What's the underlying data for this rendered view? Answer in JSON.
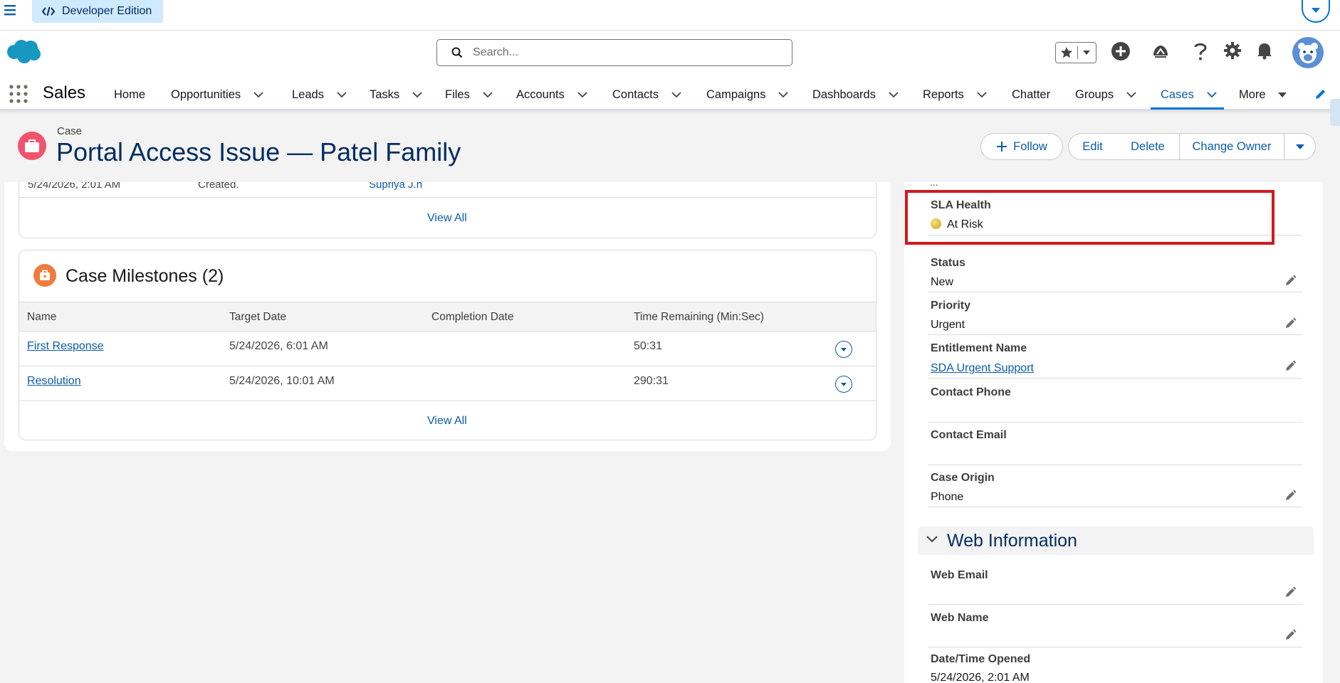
{
  "top": {
    "edition": "Developer Edition"
  },
  "header": {
    "search_placeholder": "Search..."
  },
  "nav": {
    "app_name": "Sales",
    "items": [
      {
        "label": "Home"
      },
      {
        "label": "Opportunities"
      },
      {
        "label": "Leads"
      },
      {
        "label": "Tasks"
      },
      {
        "label": "Files"
      },
      {
        "label": "Accounts"
      },
      {
        "label": "Contacts"
      },
      {
        "label": "Campaigns"
      },
      {
        "label": "Dashboards"
      },
      {
        "label": "Reports"
      },
      {
        "label": "Chatter"
      },
      {
        "label": "Groups"
      },
      {
        "label": "Cases"
      },
      {
        "label": "More"
      }
    ]
  },
  "record": {
    "type": "Case",
    "title": "Portal Access Issue — Patel Family",
    "actions": {
      "follow": "Follow",
      "edit": "Edit",
      "delete": "Delete",
      "change_owner": "Change Owner"
    }
  },
  "history_card": {
    "cut_row": [
      "5/24/2026, 2:01 AM",
      "Created.",
      "Supriya J.n"
    ],
    "view_all": "View All"
  },
  "milestones": {
    "title": "Case Milestones (2)",
    "columns": [
      "Name",
      "Target Date",
      "Completion Date",
      "Time Remaining (Min:Sec)"
    ],
    "rows": [
      {
        "name": "First Response",
        "target": "5/24/2026, 6:01 AM",
        "completion": "",
        "remaining": "50:31"
      },
      {
        "name": "Resolution",
        "target": "5/24/2026, 10:01 AM",
        "completion": "",
        "remaining": "290:31"
      }
    ],
    "view_all": "View All"
  },
  "details": {
    "dots": "...",
    "sla_health": {
      "label": "SLA Health",
      "value": "At Risk"
    },
    "status": {
      "label": "Status",
      "value": "New"
    },
    "priority": {
      "label": "Priority",
      "value": "Urgent"
    },
    "entitlement": {
      "label": "Entitlement Name",
      "value": "SDA Urgent Support"
    },
    "contact_phone": {
      "label": "Contact Phone",
      "value": ""
    },
    "contact_email": {
      "label": "Contact Email",
      "value": ""
    },
    "case_origin": {
      "label": "Case Origin",
      "value": "Phone"
    },
    "web_section": "Web Information",
    "web_email": {
      "label": "Web Email",
      "value": ""
    },
    "web_name": {
      "label": "Web Name",
      "value": ""
    },
    "date_opened": {
      "label": "Date/Time Opened",
      "value": "5/24/2026, 2:01 AM"
    }
  },
  "colors": {
    "brand": "#0176d3",
    "highlight": "#d0191f",
    "case_icon": "#f2536d",
    "milestone_icon": "#ef7b3e"
  }
}
